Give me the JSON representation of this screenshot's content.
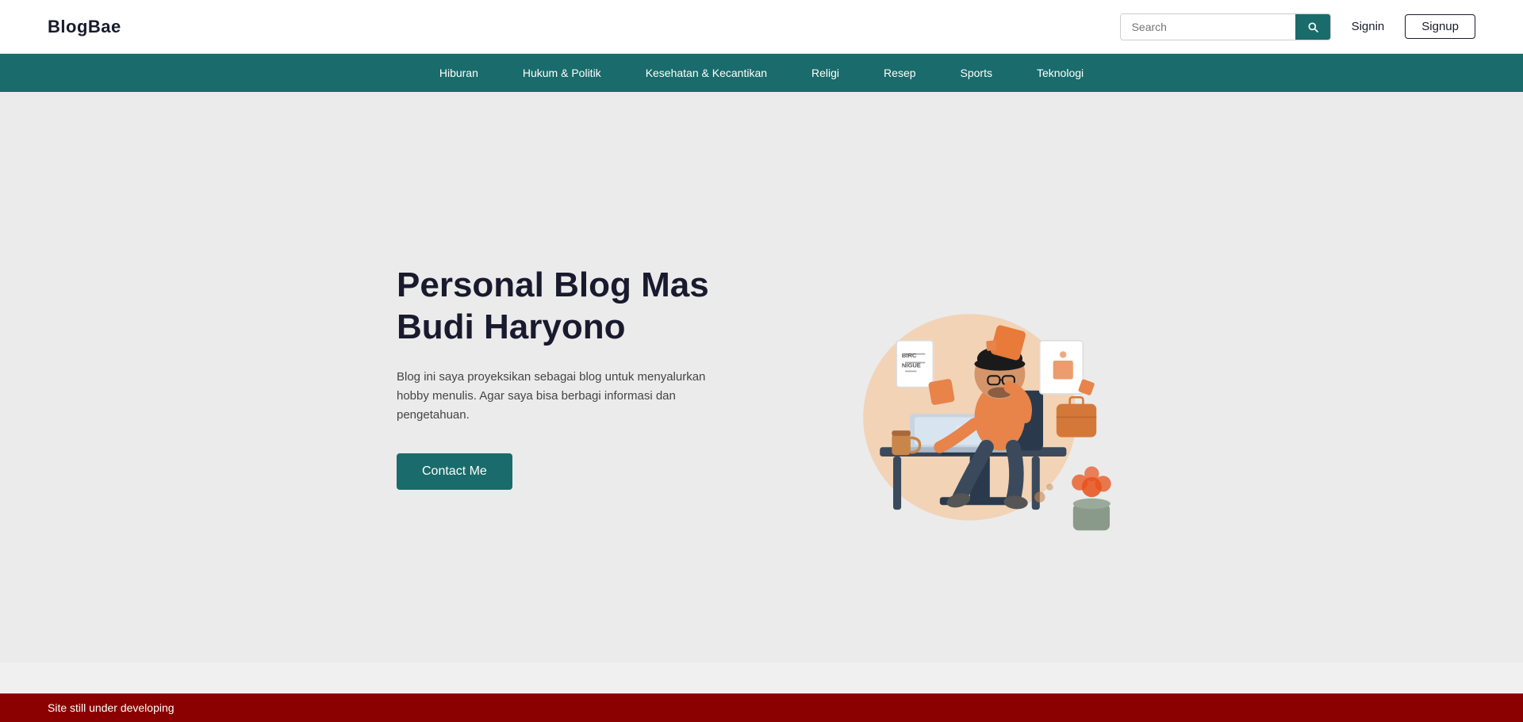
{
  "header": {
    "logo": "BlogBae",
    "search_placeholder": "Search",
    "signin_label": "Signin",
    "signup_label": "Signup"
  },
  "nav": {
    "items": [
      {
        "label": "Hiburan"
      },
      {
        "label": "Hukum & Politik"
      },
      {
        "label": "Kesehatan & Kecantikan"
      },
      {
        "label": "Religi"
      },
      {
        "label": "Resep"
      },
      {
        "label": "Sports"
      },
      {
        "label": "Teknologi"
      }
    ]
  },
  "hero": {
    "title": "Personal Blog Mas Budi Haryono",
    "description": "Blog ini saya proyeksikan sebagai blog untuk menyalurkan hobby menulis. Agar saya bisa berbagi informasi dan pengetahuan.",
    "contact_button": "Contact Me"
  },
  "footer": {
    "status_text": "Site still under developing"
  }
}
